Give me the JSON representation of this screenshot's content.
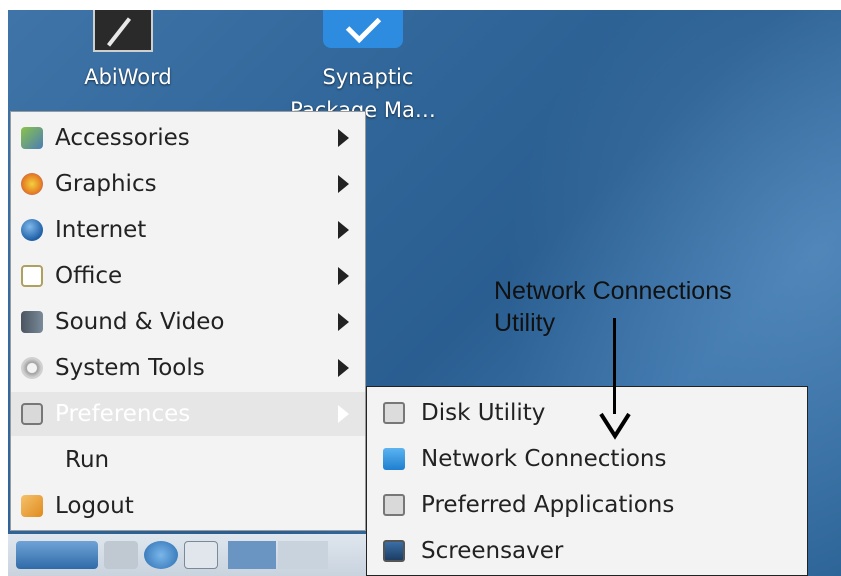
{
  "desktop": {
    "icons": [
      {
        "label": "AbiWord"
      },
      {
        "label": "Synaptic\nPackage Ma…",
        "line1": "Synaptic",
        "line2": "Package Ma…"
      }
    ]
  },
  "menu": {
    "items": [
      {
        "label": "Accessories",
        "icon": "accessories-icon",
        "submenu": true
      },
      {
        "label": "Graphics",
        "icon": "graphics-icon",
        "submenu": true
      },
      {
        "label": "Internet",
        "icon": "internet-globe-icon",
        "submenu": true
      },
      {
        "label": "Office",
        "icon": "office-icon",
        "submenu": true
      },
      {
        "label": "Sound & Video",
        "icon": "sound-video-icon",
        "submenu": true
      },
      {
        "label": "System Tools",
        "icon": "system-tools-icon",
        "submenu": true
      },
      {
        "label": "Preferences",
        "icon": "preferences-icon",
        "submenu": true,
        "active": true
      },
      {
        "label": "Run",
        "icon": null,
        "submenu": false
      },
      {
        "label": "Logout",
        "icon": "logout-icon",
        "submenu": false
      }
    ]
  },
  "submenu": {
    "items": [
      {
        "label": "Disk Utility",
        "icon": "disk-utility-icon"
      },
      {
        "label": "Network Connections",
        "icon": "network-connections-icon"
      },
      {
        "label": "Preferred Applications",
        "icon": "preferred-applications-icon"
      },
      {
        "label": "Screensaver",
        "icon": "screensaver-icon"
      }
    ]
  },
  "annotation": {
    "line1": "Network Connections",
    "line2": "Utility"
  },
  "colors": {
    "desktop": "#2f6598",
    "menu_bg": "#f3f3f3",
    "active_bg": "#e6e6e6"
  }
}
